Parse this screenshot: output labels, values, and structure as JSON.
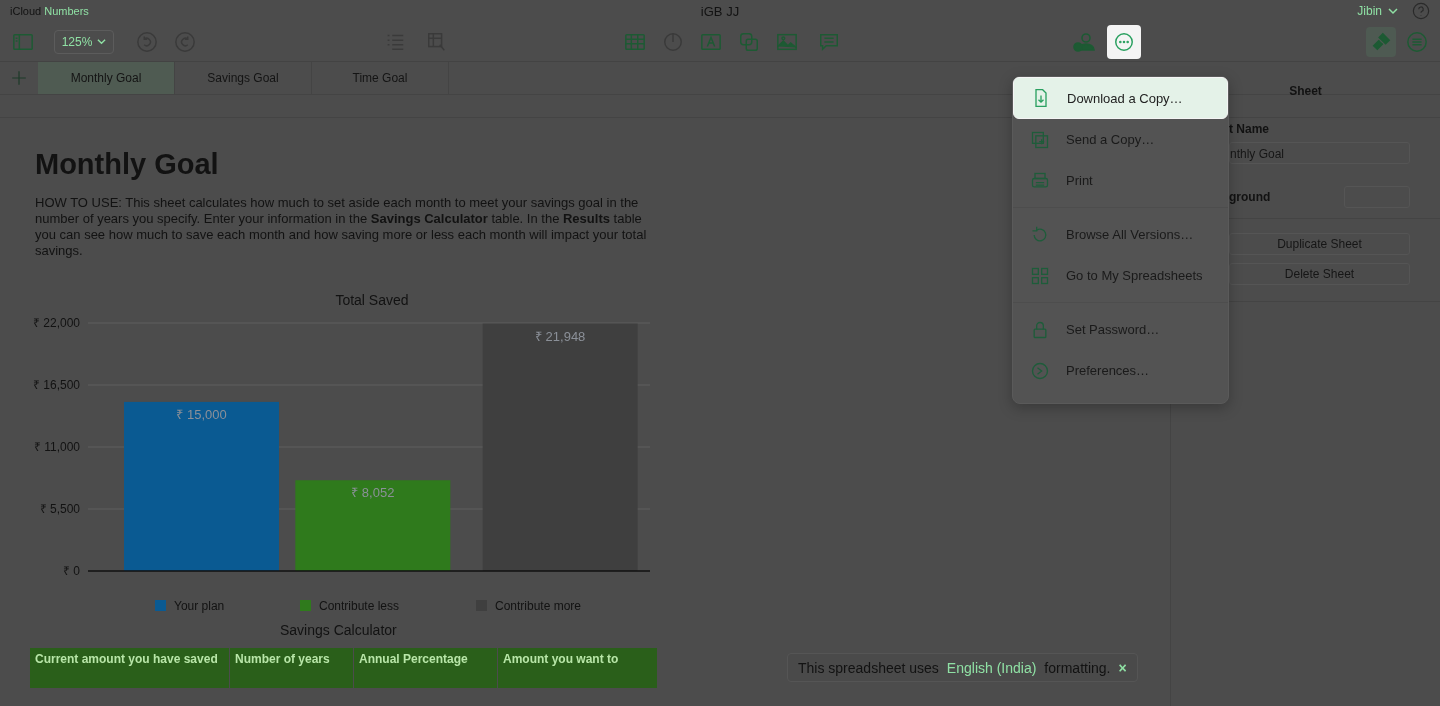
{
  "title_bar": {
    "app_prefix": "iCloud",
    "app_name": "Numbers",
    "document_title": "iGB JJ",
    "user": "Jibin"
  },
  "toolbar": {
    "zoom": "125%",
    "more_selected": true,
    "format_selected": true
  },
  "tabs": [
    {
      "label": "Monthly Goal",
      "selected": true
    },
    {
      "label": "Savings Goal",
      "selected": false
    },
    {
      "label": "Time Goal",
      "selected": false
    }
  ],
  "sheet": {
    "heading": "Monthly Goal",
    "intro": "HOW TO USE: This sheet calculates how much to set aside each month to meet your savings goal in the number of years you specify. Enter your information in the **Savings Calculator** table. In the **Results** table you can see how much to save each month and how saving more or less each month will impact your total savings.",
    "chart_data": {
      "type": "bar",
      "title": "Total Saved",
      "grid": true,
      "legend": "bottom",
      "series": [
        {
          "name": "Your plan",
          "color": "#0a5a92",
          "values": [
            15000
          ]
        },
        {
          "name": "Contribute less",
          "color": "#2f7a1c",
          "values": [
            8052
          ]
        },
        {
          "name": "Contribute more",
          "color": "#3f3f3f",
          "values": [
            21948
          ]
        }
      ],
      "ylim": [
        0,
        22000
      ],
      "yticks": [
        {
          "value": 0,
          "label": "₹ 0"
        },
        {
          "value": 5500,
          "label": "₹ 5,500"
        },
        {
          "value": 11000,
          "label": "₹ 11,000"
        },
        {
          "value": 16500,
          "label": "₹ 16,500"
        },
        {
          "value": 22000,
          "label": "₹ 22,000"
        }
      ],
      "value_labels": [
        "₹ 15,000",
        "₹ 8,052",
        "₹ 21,948"
      ]
    },
    "table_title": "Savings Calculator",
    "table_columns": [
      "Current amount you have saved",
      "Number of years",
      "Annual Percentage",
      "Amount you want to"
    ]
  },
  "toast": {
    "before": "This spreadsheet uses",
    "link": "English (India)",
    "after": "formatting.",
    "close": "×"
  },
  "panel": {
    "header": "Sheet",
    "name_label": "t Name",
    "name_value": "nthly Goal",
    "background_label": "ground",
    "buttons": [
      "Duplicate Sheet",
      "Delete Sheet"
    ]
  },
  "menu": {
    "groups": [
      [
        {
          "label": "Download a Copy…",
          "selected": true
        },
        {
          "label": "Send a Copy…",
          "selected": false
        },
        {
          "label": "Print",
          "selected": false
        }
      ],
      [
        {
          "label": "Browse All Versions…",
          "selected": false
        },
        {
          "label": "Go to My Spreadsheets",
          "selected": false
        }
      ],
      [
        {
          "label": "Set Password…",
          "selected": false
        },
        {
          "label": "Preferences…",
          "selected": false
        }
      ]
    ]
  }
}
